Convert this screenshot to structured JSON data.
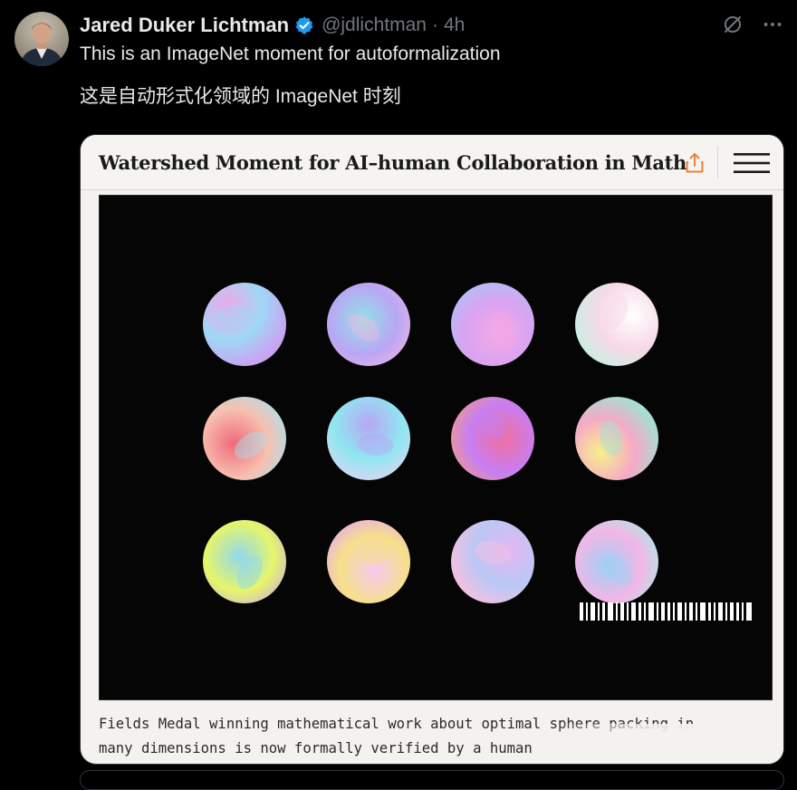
{
  "author": {
    "name": "Jared Duker Lichtman",
    "handle": "@jdlichtman",
    "separator": "·",
    "time": "4h",
    "verified": true
  },
  "icons": {
    "avatar": "profile-photo",
    "verified": "verified-badge-icon",
    "grok": "grok-icon",
    "more": "more-options-icon",
    "share": "share-icon",
    "menu": "hamburger-menu-icon"
  },
  "tweet": {
    "line1": "This is an ImageNet moment for autoformalization",
    "line2": "这是自动形式化领域的 ImageNet 时刻"
  },
  "card": {
    "title": "Watershed Moment for AI–human Collaboration in Math",
    "caption_line1": "Fields Medal winning mathematical work about optimal sphere packing in",
    "caption_line2": "many dimensions is now formally verified by a human",
    "sphere_count": 12
  },
  "colors": {
    "background": "#000000",
    "text": "#e7e9ea",
    "muted": "#71767b",
    "verified": "#1d9bf0",
    "card_bg": "#f4f2ee",
    "share_accent": "#e8833a"
  }
}
